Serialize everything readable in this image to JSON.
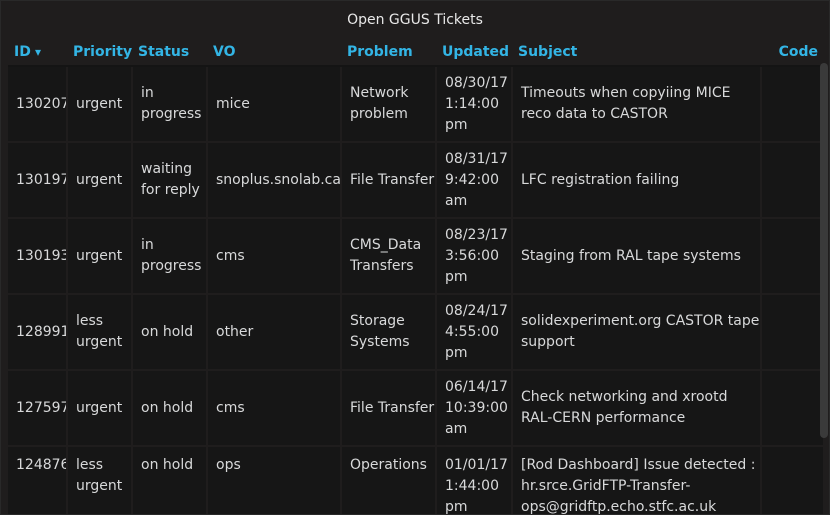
{
  "panel": {
    "title": "Open GGUS Tickets"
  },
  "columns": [
    "ID",
    "Priority",
    "Status",
    "VO",
    "Problem",
    "Updated",
    "Subject",
    "Code"
  ],
  "rows": [
    {
      "id": "130207",
      "priority": "urgent",
      "status": "in progress",
      "vo": "mice",
      "problem": "Network problem",
      "updated": "08/30/17 1:14:00 pm",
      "subject": "Timeouts when copyiing MICE reco data to CASTOR",
      "code": ""
    },
    {
      "id": "130197",
      "priority": "urgent",
      "status": "waiting for reply",
      "vo": "snoplus.snolab.ca",
      "problem": "File Transfer",
      "updated": "08/31/17 9:42:00 am",
      "subject": "LFC registration failing",
      "code": ""
    },
    {
      "id": "130193",
      "priority": "urgent",
      "status": "in progress",
      "vo": "cms",
      "problem": "CMS_Data Transfers",
      "updated": "08/23/17 3:56:00 pm",
      "subject": "Staging from RAL tape systems",
      "code": ""
    },
    {
      "id": "128991",
      "priority": "less urgent",
      "status": "on hold",
      "vo": "other",
      "problem": "Storage Systems",
      "updated": "08/24/17 4:55:00 pm",
      "subject": "solidexperiment.org CASTOR tape support",
      "code": ""
    },
    {
      "id": "127597",
      "priority": "urgent",
      "status": "on hold",
      "vo": "cms",
      "problem": "File Transfer",
      "updated": "06/14/17 10:39:00 am",
      "subject": "Check networking and xrootd RAL-CERN performance",
      "code": ""
    },
    {
      "id": "124876",
      "priority": "less urgent",
      "status": "on hold",
      "vo": "ops",
      "problem": "Operations",
      "updated": "01/01/17 1:44:00 pm",
      "subject": "[Rod Dashboard] Issue detected : hr.srce.GridFTP-Transfer-ops@gridftp.echo.stfc.ac.uk",
      "code": ""
    }
  ]
}
